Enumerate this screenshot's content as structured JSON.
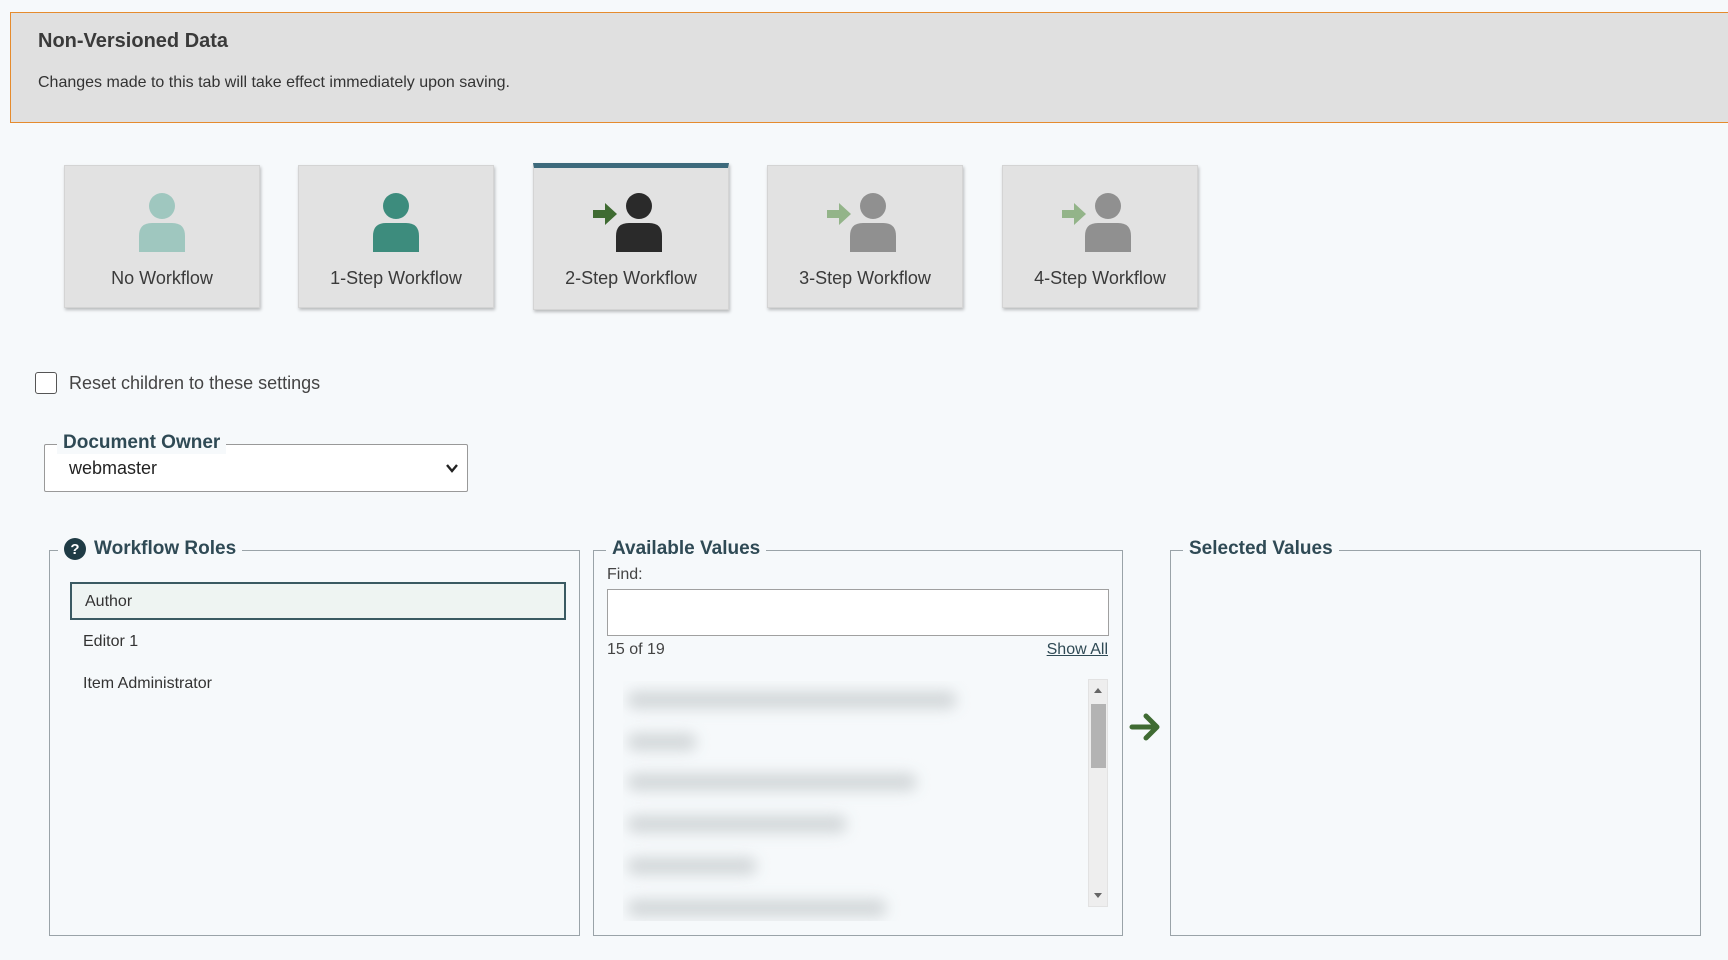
{
  "notice": {
    "title": "Non-Versioned Data",
    "text": "Changes made to this tab will take effect immediately upon saving."
  },
  "workflows": [
    {
      "label": "No Workflow",
      "icon": "user-icon",
      "color": "#9fc7bf"
    },
    {
      "label": "1-Step Workflow",
      "icon": "user-icon",
      "color": "#3d8c7d"
    },
    {
      "label": "2-Step Workflow",
      "icon": "user-arrow-icon",
      "color": "#2a2a2a",
      "arrow_color": "#3f6b32",
      "active": true
    },
    {
      "label": "3-Step Workflow",
      "icon": "user-arrow-icon",
      "color": "#909090",
      "arrow_color": "#93b489"
    },
    {
      "label": "4-Step Workflow",
      "icon": "user-arrow-icon",
      "color": "#909090",
      "arrow_color": "#93b489"
    }
  ],
  "reset": {
    "label": "Reset children to these settings",
    "checked": false
  },
  "document_owner": {
    "legend": "Document Owner",
    "value": "webmaster"
  },
  "workflow_roles": {
    "legend": "Workflow Roles",
    "items": [
      "Author",
      "Editor 1",
      "Item Administrator"
    ],
    "selected": "Author"
  },
  "available_values": {
    "legend": "Available Values",
    "find_label": "Find:",
    "find_value": "",
    "count": "15 of 19",
    "show_all": "Show All"
  },
  "selected_values": {
    "legend": "Selected Values"
  },
  "colors": {
    "accent": "#2f4a55",
    "notice_border": "#e58b2e",
    "move_arrow": "#3f6b32"
  }
}
